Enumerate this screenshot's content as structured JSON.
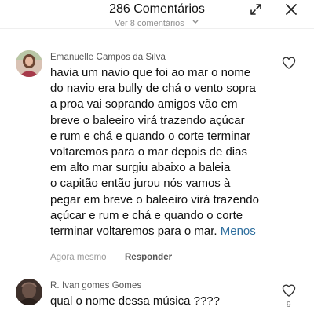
{
  "header": {
    "title": "286 Comentários",
    "expand_icon": "expand-icon",
    "close_icon": "close-icon"
  },
  "cut_link": {
    "label": "Ver 8 comentários"
  },
  "comments": [
    {
      "username": "Emanuelle Campos da Silva",
      "avatar_icon": "avatar-photo",
      "lines": [
        "havia um navio que foi ao mar o nome",
        "do navio era bully de chá o vento sopra",
        "a proa vai soprando amigos vão em",
        "breve o baleeiro virá trazendo açúcar",
        "e rum e chá e quando o corte terminar",
        "voltaremos para o mar depois de dias",
        "em alto mar surgiu abaixo a baleia",
        "o capitão então jurou nós vamos à",
        "pegar em breve o baleeiro virá trazendo",
        "açúcar e rum e chá e quando o corte",
        "terminar voltaremos para o mar."
      ],
      "less_label": "Menos",
      "time": "Agora mesmo",
      "reply_label": "Responder",
      "like_icon": "heart-icon"
    },
    {
      "username": "R. Ivan gomes Gomes",
      "avatar_icon": "avatar-photo",
      "text": "qual o nome dessa música ????",
      "like_icon": "heart-icon",
      "like_count": "9"
    }
  ]
}
